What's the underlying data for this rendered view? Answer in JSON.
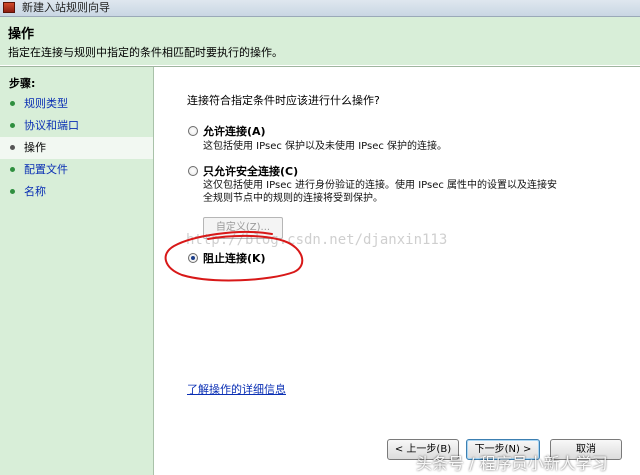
{
  "window": {
    "title": "新建入站规则向导"
  },
  "header": {
    "title": "操作",
    "description": "指定在连接与规则中指定的条件相匹配时要执行的操作。"
  },
  "steps": {
    "heading": "步骤:",
    "items": [
      {
        "label": "规则类型",
        "current": false
      },
      {
        "label": "协议和端口",
        "current": false
      },
      {
        "label": "操作",
        "current": true
      },
      {
        "label": "配置文件",
        "current": false
      },
      {
        "label": "名称",
        "current": false
      }
    ]
  },
  "content": {
    "question": "连接符合指定条件时应该进行什么操作?",
    "options": [
      {
        "label": "允许连接(A)",
        "description": "这包括使用 IPsec 保护以及未使用 IPsec 保护的连接。",
        "selected": false
      },
      {
        "label": "只允许安全连接(C)",
        "description_lines": [
          "这仅包括使用 IPsec 进行身份验证的连接。使用 IPsec 属性中的设置以及连接安",
          "全规则节点中的规则的连接将受到保护。"
        ],
        "selected": false
      },
      {
        "label": "阻止连接(K)",
        "selected": true
      }
    ],
    "customize_button": "自定义(Z)...",
    "learn_more_link": "了解操作的详细信息"
  },
  "buttons": {
    "back": "< 上一步(B)",
    "next": "下一步(N) >",
    "cancel": "取消"
  },
  "watermark": "http://blog.csdn.net/djanxin113",
  "corner_watermark": "头条号 / 程序员小新人学习",
  "colors": {
    "header_bg": "#d8eed8",
    "link": "#0a2fb4",
    "annotation": "#d81818"
  }
}
